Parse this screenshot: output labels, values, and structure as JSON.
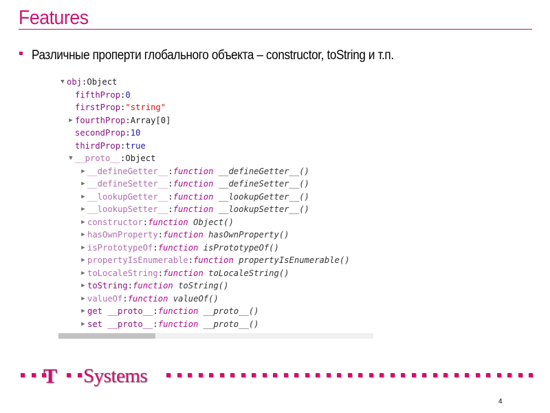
{
  "slide": {
    "title": "Features",
    "bullet": "Различные проперти глобального объекта – constructor, toString и т.п.",
    "page_number": "4"
  },
  "console": {
    "root": {
      "key": "obj",
      "value": "Object",
      "expanded": true
    },
    "props": [
      {
        "key": "fifthProp",
        "value": "0",
        "type": "num",
        "expandable": false
      },
      {
        "key": "firstProp",
        "value": "\"string\"",
        "type": "str",
        "expandable": false
      },
      {
        "key": "fourthProp",
        "value": "Array[0]",
        "type": "obj",
        "expandable": true
      },
      {
        "key": "secondProp",
        "value": "10",
        "type": "num",
        "expandable": false
      },
      {
        "key": "thirdProp",
        "value": "true",
        "type": "bool",
        "expandable": false
      }
    ],
    "proto": {
      "key": "__proto__",
      "value": "Object",
      "expanded": true
    },
    "proto_items": [
      {
        "key": "__defineGetter__",
        "fn": "function",
        "name": "__defineGetter__()",
        "dim": true
      },
      {
        "key": "__defineSetter__",
        "fn": "function",
        "name": "__defineSetter__()",
        "dim": true
      },
      {
        "key": "__lookupGetter__",
        "fn": "function",
        "name": "__lookupGetter__()",
        "dim": true
      },
      {
        "key": "__lookupSetter__",
        "fn": "function",
        "name": "__lookupSetter__()",
        "dim": true
      },
      {
        "key": "constructor",
        "fn": "function",
        "name": "Object()",
        "dim": true
      },
      {
        "key": "hasOwnProperty",
        "fn": "function",
        "name": "hasOwnProperty()",
        "dim": true
      },
      {
        "key": "isPrototypeOf",
        "fn": "function",
        "name": "isPrototypeOf()",
        "dim": true
      },
      {
        "key": "propertyIsEnumerable",
        "fn": "function",
        "name": "propertyIsEnumerable()",
        "dim": true
      },
      {
        "key": "toLocaleString",
        "fn": "function",
        "name": "toLocaleString()",
        "dim": true
      },
      {
        "key": "toString",
        "fn": "function",
        "name": "toString()",
        "dim": false
      },
      {
        "key": "valueOf",
        "fn": "function",
        "name": "valueOf()",
        "dim": true
      },
      {
        "key": "get __proto__",
        "fn": "function",
        "name": "__proto__()",
        "dim": false
      },
      {
        "key": "set __proto__",
        "fn": "function",
        "name": "__proto__()",
        "dim": false
      }
    ],
    "separator": ": "
  },
  "footer": {
    "logo_t": "T",
    "logo_word": "Systems",
    "brand_color": "#d0106e"
  },
  "colors": {
    "title": "#c8176f",
    "key": "#881280",
    "number": "#1a1aa6",
    "string": "#c41a16",
    "function_keyword": "#aa0d91"
  }
}
